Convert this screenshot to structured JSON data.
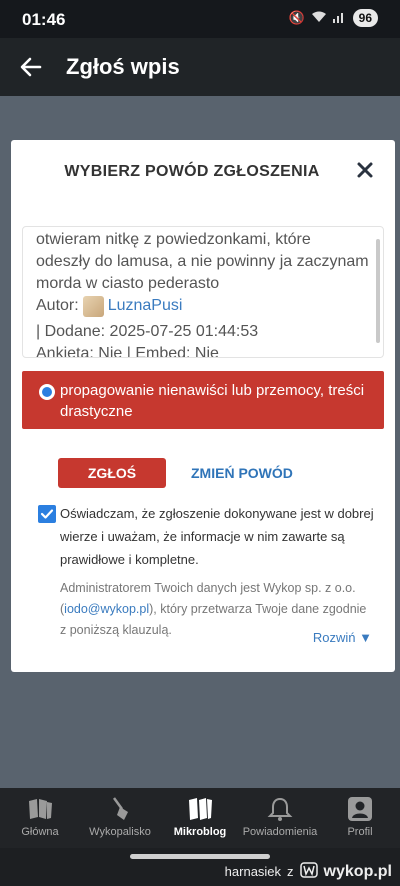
{
  "status": {
    "time": "01:46",
    "battery": "96"
  },
  "app_bar": {
    "title": "Zgłoś wpis"
  },
  "modal": {
    "title": "WYBIERZ POWÓD ZGŁOSZENIA",
    "entry": {
      "text": "otwieram nitkę z powiedzonkami, które odeszły do lamusa, a nie powinny ja zaczynam morda w ciasto pederasto",
      "author_label": "Autor:",
      "author_name": "LuznaPusi",
      "date_label": "| Dodane: 2025-07-25 01:44:53",
      "meta": "Ankieta: Nie | Embed: Nie"
    },
    "reason": "propagowanie nienawiści lub przemocy, treści drastyczne",
    "report_button": "ZGŁOŚ",
    "change_button": "ZMIEŃ POWÓD",
    "consent": "Oświadczam, że zgłoszenie dokonywane jest w dobrej wierze i uważam, że informacje w nim zawarte są prawidłowe i kompletne.",
    "admin": {
      "before": "Administratorem Twoich danych jest Wykop sp. z o.o. (",
      "link": "iodo@wykop.pl",
      "after": "), który przetwarza Twoje dane zgodnie z poniższą klauzulą."
    },
    "expand": "Rozwiń ▼"
  },
  "bottom_nav": {
    "items": [
      {
        "label": "Główna",
        "icon": "home-icon"
      },
      {
        "label": "Wykopalisko",
        "icon": "shovel-icon"
      },
      {
        "label": "Mikroblog",
        "icon": "mikroblog-icon",
        "active": true
      },
      {
        "label": "Powiadomienia",
        "icon": "bell-icon"
      },
      {
        "label": "Profil",
        "icon": "profile-icon"
      }
    ]
  },
  "watermark": {
    "user": "harnasiek",
    "sep": "z",
    "brand": "wykop.pl"
  }
}
